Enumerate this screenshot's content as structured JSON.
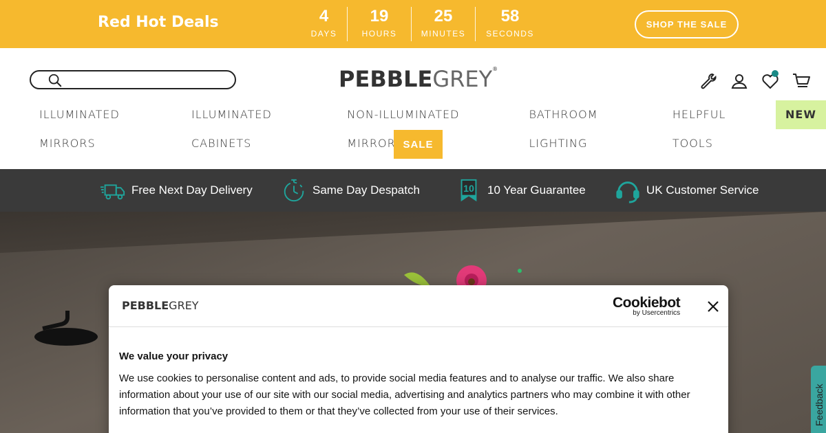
{
  "promo": {
    "title": "Red Hot Deals",
    "countdown": [
      {
        "value": "4",
        "label": "DAYS"
      },
      {
        "value": "19",
        "label": "HOURS"
      },
      {
        "value": "25",
        "label": "MINUTES"
      },
      {
        "value": "58",
        "label": "SECONDS"
      }
    ],
    "cta": "SHOP THE SALE",
    "color": "#f6b92e"
  },
  "header": {
    "logo_part1": "PEBBLE",
    "logo_part2": "GREY",
    "logo_mark": "®",
    "search_placeholder": "",
    "icons": [
      "wrench-icon",
      "account-icon",
      "wishlist-heart-icon",
      "cart-icon"
    ]
  },
  "nav": {
    "items": [
      "ILLUMINATED MIRRORS",
      "ILLUMINATED CABINETS",
      "NON-ILLUMINATED MIRRORS",
      "BATHROOM LIGHTING",
      "HELPFUL TOOLS"
    ],
    "new_label": "NEW",
    "sale_label": "SALE"
  },
  "usp": [
    {
      "icon": "delivery-truck-icon",
      "label": "Free Next Day Delivery"
    },
    {
      "icon": "stopwatch-icon",
      "label": "Same Day Despatch"
    },
    {
      "icon": "guarantee-badge-icon",
      "label": "10 Year Guarantee",
      "badge": "10"
    },
    {
      "icon": "headset-icon",
      "label": "UK Customer Service"
    }
  ],
  "accent_teal": "#1a8a86",
  "cookie": {
    "logo_part1": "PEBBLE",
    "logo_part2": "GREY",
    "brand": "Cookiebot",
    "brand_sub": "by Usercentrics",
    "title": "We value your privacy",
    "text": "We use cookies to personalise content and ads, to provide social media features and to analyse our traffic. We also share information about your use of our site with our social media, advertising and analytics partners who may combine it with other information that you’ve provided to them or that they’ve collected from your use of their services."
  },
  "feedback_label": "Feedback"
}
